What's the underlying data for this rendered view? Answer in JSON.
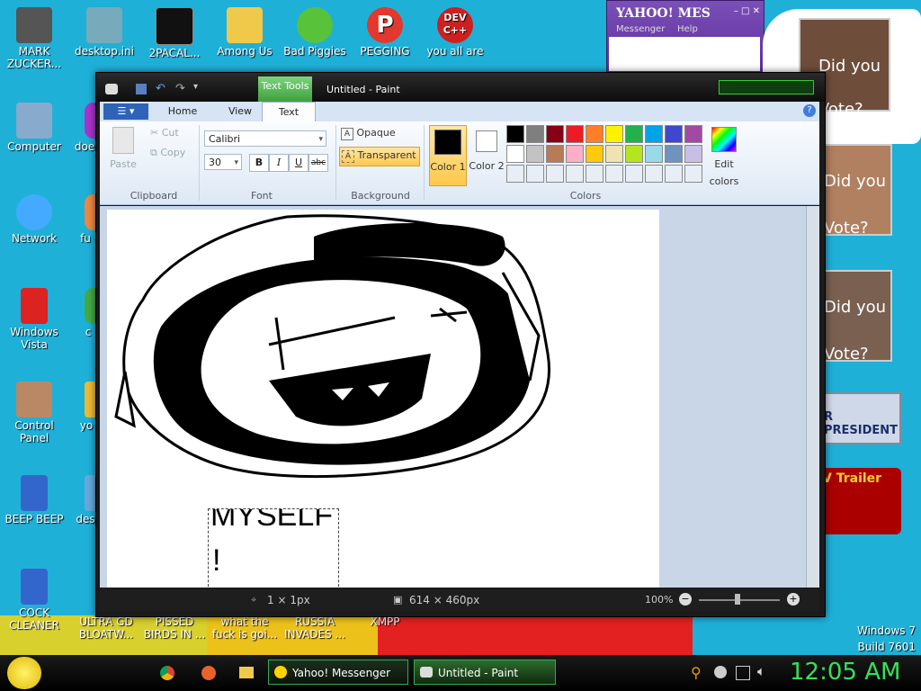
{
  "desktop": {
    "icons": [
      {
        "label": "MARK ZUCKER...",
        "color": "#555"
      },
      {
        "label": "desktop.ini",
        "color": "#7ab"
      },
      {
        "label": "2PACAL...",
        "color": "#222"
      },
      {
        "label": "Among Us",
        "color": "#6cc"
      },
      {
        "label": "Bad Piggies",
        "color": "#4c4"
      },
      {
        "label": "PEGGING",
        "color": "#d33"
      },
      {
        "label": "you all are",
        "color": "#c22"
      },
      {
        "label": "Computer",
        "color": "#8ac"
      },
      {
        "label": "doe",
        "color": "#a3c"
      },
      {
        "label": "Network",
        "color": "#4af"
      },
      {
        "label": "fu",
        "color": "#e84"
      },
      {
        "label": "Windows Vista",
        "color": "#d22"
      },
      {
        "label": "c",
        "color": "#4a4"
      },
      {
        "label": "Control Panel",
        "color": "#b86"
      },
      {
        "label": "yo",
        "color": "#eb3"
      },
      {
        "label": "BEEP BEEP",
        "color": "#36c"
      },
      {
        "label": "des",
        "color": "#6ad"
      },
      {
        "label": "COCK CLEANER",
        "color": "#36c"
      },
      {
        "label": "ULTRA GD BLOATW...",
        "color": "#555"
      },
      {
        "label": "PISSED BIRDS IN ...",
        "color": "#888"
      },
      {
        "label": "what the fuck is goi...",
        "color": "#888"
      },
      {
        "label": "RUSSIA INVADES ...",
        "color": "#888"
      },
      {
        "label": "XMPP",
        "color": "#888"
      }
    ],
    "os_label": "Windows 7",
    "build_label": "Build 7601"
  },
  "yahoo": {
    "logo": "YAHOO! MES",
    "tabs": [
      "Messenger",
      "Help"
    ]
  },
  "ads": [
    {
      "text": "Did you Vote?"
    },
    {
      "text": "Did you Vote?"
    },
    {
      "text": "Did you Vote?"
    },
    {
      "text": "R PRESIDENT"
    },
    {
      "text": "V Trailer"
    }
  ],
  "paint": {
    "title": "Untitled - Paint",
    "context_tab": "Text Tools",
    "tabs": [
      "Home",
      "View",
      "Text"
    ],
    "clipboard": {
      "paste": "Paste",
      "cut": "Cut",
      "copy": "Copy",
      "label": "Clipboard"
    },
    "font": {
      "family": "Calibri",
      "size": "30",
      "label": "Font",
      "bold": "B",
      "italic": "I",
      "underline": "U",
      "strike": "abc"
    },
    "background": {
      "opaque": "Opaque",
      "transparent": "Transparent",
      "label": "Background"
    },
    "colors": {
      "color1": "Color 1",
      "color2": "Color 2",
      "label": "Colors",
      "edit": "Edit colors",
      "palette_row1": [
        "#000000",
        "#7f7f7f",
        "#880015",
        "#ed1c24",
        "#ff7f27",
        "#fff200",
        "#22b14c",
        "#00a2e8",
        "#3f48cc",
        "#a349a4"
      ],
      "palette_row2": [
        "#ffffff",
        "#c3c3c3",
        "#b97a57",
        "#ffaec9",
        "#ffc90e",
        "#efe4b0",
        "#b5e61d",
        "#99d9ea",
        "#7092be",
        "#c8bfe7"
      ]
    },
    "canvas_text_line1": "MYSELF",
    "canvas_text_line2": "!",
    "status": {
      "cursor": "1 × 1px",
      "size": "614 × 460px",
      "zoom": "100%"
    }
  },
  "taskbar": {
    "items": [
      "Yahoo! Messenger",
      "Untitled - Paint"
    ],
    "clock": "12:05 AM"
  }
}
